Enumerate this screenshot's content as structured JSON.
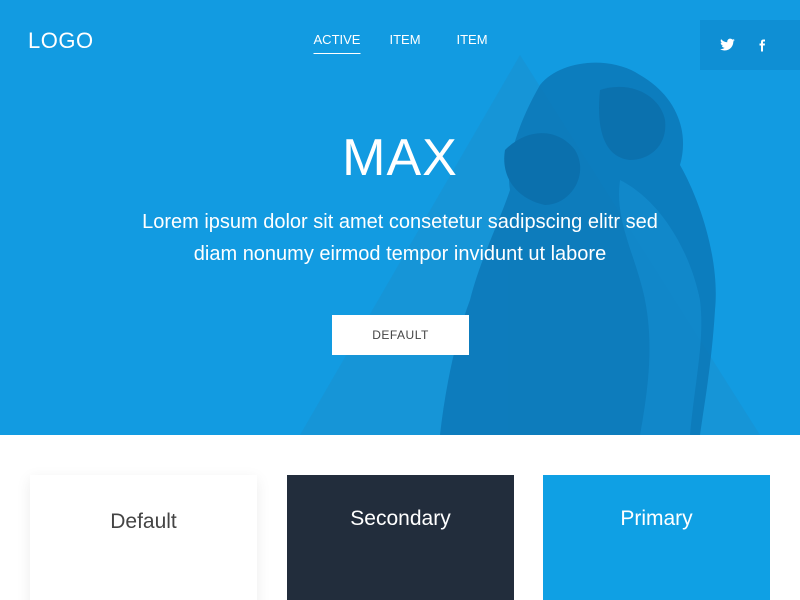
{
  "header": {
    "logo": "LOGO",
    "nav": [
      {
        "label": "ACTIVE",
        "active": true
      },
      {
        "label": "ITEM",
        "active": false
      },
      {
        "label": "ITEM",
        "active": false
      }
    ],
    "social": [
      "twitter-icon",
      "facebook-icon"
    ]
  },
  "hero": {
    "title": "MAX",
    "lead_line1": "Lorem ipsum dolor sit amet consetetur sadipscing elitr sed",
    "lead_line2": "diam nonumy eirmod tempor invidunt ut labore",
    "button": "DEFAULT"
  },
  "cards": [
    {
      "title": "Default"
    },
    {
      "title": "Secondary"
    },
    {
      "title": "Primary"
    }
  ],
  "colors": {
    "hero_bg": "#129be1",
    "secondary_card": "#222d3c",
    "primary_card": "#0fa0e4"
  }
}
